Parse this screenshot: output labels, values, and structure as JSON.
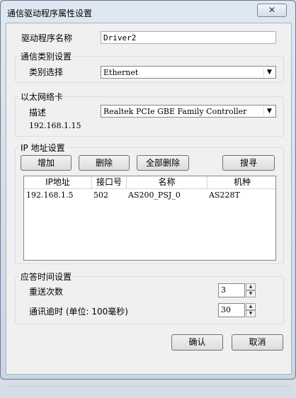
{
  "window": {
    "title": "通信驱动程序属性设置",
    "close_glyph": "✕"
  },
  "driver": {
    "label": "驱动程序名称",
    "value": "Driver2"
  },
  "comm_type": {
    "group_title": "通信类别设置",
    "label": "类别选择",
    "selected": "Ethernet"
  },
  "nic": {
    "group_title": "以太网络卡",
    "label": "描述",
    "selected": "Realtek PCIe GBE Family Controller",
    "ip": "192.168.1.15"
  },
  "ip_settings": {
    "group_title": "IP 地址设置",
    "buttons": {
      "add": "增加",
      "delete": "删除",
      "delete_all": "全部删除",
      "search": "搜寻"
    },
    "columns": [
      "IP地址",
      "接口号",
      "名称",
      "机种"
    ],
    "rows": [
      {
        "ip": "192.168.1.5",
        "port": "502",
        "name": "AS200_PSJ_0",
        "model": "AS228T"
      }
    ]
  },
  "response": {
    "group_title": "应答时间设置",
    "retry_label": "重送次数",
    "retry_value": "3",
    "timeout_label": "通讯逾时 (单位: 100毫秒)",
    "timeout_value": "30"
  },
  "dialog": {
    "ok": "确认",
    "cancel": "取消"
  },
  "icons": {
    "dropdown": "▼",
    "spin_up": "▲",
    "spin_down": "▼"
  }
}
